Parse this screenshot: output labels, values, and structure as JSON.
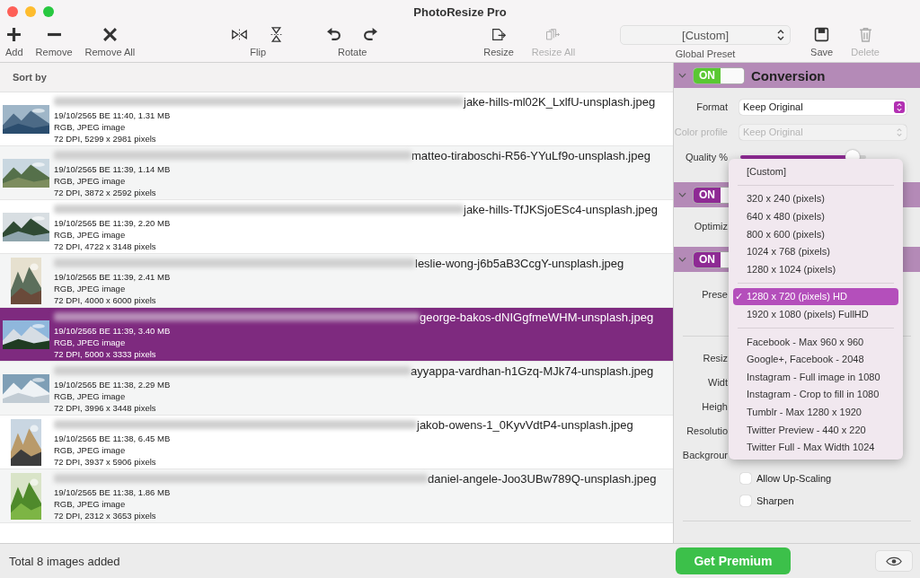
{
  "window": {
    "title": "PhotoResize Pro"
  },
  "toolbar": [
    {
      "label": "Add",
      "disabled": false
    },
    {
      "label": "Remove",
      "disabled": false
    },
    {
      "label": "Remove All",
      "disabled": false
    },
    {
      "label": "Flip",
      "disabled": false
    },
    {
      "label": "Rotate",
      "disabled": false
    },
    {
      "label": "Resize",
      "disabled": false
    },
    {
      "label": "Resize All",
      "disabled": true
    },
    {
      "label": "Save",
      "disabled": false
    },
    {
      "label": "Delete",
      "disabled": true
    }
  ],
  "global_preset": {
    "value": "[Custom]",
    "label": "Global Preset"
  },
  "list": {
    "header": "Sort by",
    "rows": [
      {
        "file": "jake-hills-ml02K_LxlfU-unsplash.jpeg",
        "info": [
          "19/10/2565 BE 11:40, 1.31 MB",
          "RGB, JPEG image",
          "72 DPI, 5299 x 2981 pixels"
        ],
        "selected": false
      },
      {
        "file": "matteo-tiraboschi-R56-YYuLf9o-unsplash.jpeg",
        "info": [
          "19/10/2565 BE 11:39, 1.14 MB",
          "RGB, JPEG image",
          "72 DPI, 3872 x 2592 pixels"
        ],
        "selected": false
      },
      {
        "file": "jake-hills-TfJKSjoESc4-unsplash.jpeg",
        "info": [
          "19/10/2565 BE 11:39, 2.20 MB",
          "RGB, JPEG image",
          "72 DPI, 4722 x 3148 pixels"
        ],
        "selected": false
      },
      {
        "file": "leslie-wong-j6b5aB3CcgY-unsplash.jpeg",
        "info": [
          "19/10/2565 BE 11:39, 2.41 MB",
          "RGB, JPEG image",
          "72 DPI, 4000 x 6000 pixels"
        ],
        "selected": false
      },
      {
        "file": "george-bakos-dNIGgfmeWHM-unsplash.jpeg",
        "info": [
          "19/10/2565 BE 11:39, 3.40 MB",
          "RGB, JPEG image",
          "72 DPI, 5000 x 3333 pixels"
        ],
        "selected": true
      },
      {
        "file": "ayyappa-vardhan-h1Gzq-MJk74-unsplash.jpeg",
        "info": [
          "19/10/2565 BE 11:38, 2.29 MB",
          "RGB, JPEG image",
          "72 DPI, 3996 x 3448 pixels"
        ],
        "selected": false
      },
      {
        "file": "jakob-owens-1_0KyvVdtP4-unsplash.jpeg",
        "info": [
          "19/10/2565 BE 11:38, 6.45 MB",
          "RGB, JPEG image",
          "72 DPI, 3937 x 5906 pixels"
        ],
        "selected": false
      },
      {
        "file": "daniel-angele-Joo3UBw789Q-unsplash.jpeg",
        "info": [
          "19/10/2565 BE 11:38, 1.86 MB",
          "RGB, JPEG image",
          "72 DPI, 2312 x 3653 pixels"
        ],
        "selected": false
      }
    ]
  },
  "panel": {
    "sections": [
      {
        "on": true,
        "state_text": "ON",
        "color": "#5ac833",
        "title": "Conversion",
        "rows": [
          {
            "kind": "select",
            "label": "Format",
            "value": "Keep Original",
            "disabled": false
          },
          {
            "kind": "select",
            "label": "Color profile",
            "value": "Keep Original",
            "disabled": true
          },
          {
            "kind": "slider",
            "label": "Quality %",
            "level": 0.95
          }
        ]
      },
      {
        "on": true,
        "state_text": "ON",
        "color": "#8e2a94",
        "rows": [
          {
            "kind": "label",
            "label": "Optimiz"
          }
        ]
      },
      {
        "on": true,
        "state_text": "ON",
        "color": "#8e2a94",
        "rows": [
          {
            "kind": "label",
            "label": "Prese"
          },
          {
            "kind": "divider"
          },
          {
            "kind": "label",
            "label": "Resiz"
          },
          {
            "kind": "label",
            "label": "Widt"
          },
          {
            "kind": "label",
            "label": "Heigh"
          },
          {
            "kind": "label",
            "label": "Resolutio"
          },
          {
            "kind": "label",
            "label": "Backgrour"
          },
          {
            "kind": "checkbox",
            "label": "Allow Up-Scaling",
            "checked": false
          },
          {
            "kind": "checkbox",
            "label": "Sharpen",
            "checked": false
          },
          {
            "kind": "divider"
          }
        ]
      }
    ]
  },
  "preset_menu": [
    {
      "kind": "item",
      "label": "[Custom]",
      "selected": false
    },
    {
      "kind": "separator"
    },
    {
      "kind": "item",
      "label": "320 x 240 (pixels)",
      "selected": false
    },
    {
      "kind": "item",
      "label": "640 x 480 (pixels)",
      "selected": false
    },
    {
      "kind": "item",
      "label": "800 x 600 (pixels)",
      "selected": false
    },
    {
      "kind": "item",
      "label": "1024 x 768 (pixels)",
      "selected": false
    },
    {
      "kind": "item",
      "label": "1280 x 1024 (pixels)",
      "selected": false
    },
    {
      "kind": "separator"
    },
    {
      "kind": "item",
      "label": "1280 x 720 (pixels) HD",
      "selected": true,
      "check": "✓"
    },
    {
      "kind": "item",
      "label": "1920 x 1080 (pixels) FullHD",
      "selected": false
    },
    {
      "kind": "separator"
    },
    {
      "kind": "item",
      "label": "Facebook - Max 960 x 960",
      "selected": false
    },
    {
      "kind": "item",
      "label": "Google+, Facebook - 2048",
      "selected": false
    },
    {
      "kind": "item",
      "label": "Instagram - Full image in 1080",
      "selected": false
    },
    {
      "kind": "item",
      "label": "Instagram - Crop to fill in 1080",
      "selected": false
    },
    {
      "kind": "item",
      "label": "Tumblr - Max 1280 x 1920",
      "selected": false
    },
    {
      "kind": "item",
      "label": "Twitter Preview - 440 x 220",
      "selected": false
    },
    {
      "kind": "item",
      "label": "Twitter Full - Max Width 1024",
      "selected": false
    }
  ],
  "status_bar": {
    "text": "Total 8 images added",
    "premium": "Get Premium"
  }
}
